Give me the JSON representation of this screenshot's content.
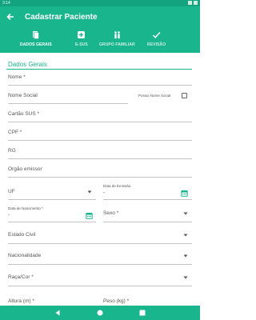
{
  "status_bar": {
    "time": "3:14"
  },
  "app_bar": {
    "title": "Cadastrar Paciente",
    "tabs": [
      {
        "label": "DADOS GERAIS",
        "icon": "document-icon",
        "active": true
      },
      {
        "label": "E-SUS",
        "icon": "medical-plus-icon",
        "active": false
      },
      {
        "label": "GRUPO FAMILIAR",
        "icon": "family-icon",
        "active": false
      },
      {
        "label": "REVISÃO",
        "icon": "check-icon",
        "active": false
      }
    ]
  },
  "form": {
    "section_title": "Dados Gerais",
    "nome": "Nome *",
    "nome_social": "Nome Social",
    "possui_nome_social": "Possui Nome Social",
    "cartao_sus": "Cartão SUS *",
    "cpf": "CPF *",
    "rg": "RG",
    "orgao_emissor": "Orgão emissor",
    "uf": "UF",
    "data_emissao_label": "Data de Emissão",
    "data_emissao_value": "-",
    "data_nascimento_label": "Data de Nascimento *",
    "data_nascimento_value": "-",
    "sexo": "Sexo *",
    "estado_civil": "Estado Civil",
    "nacionalidade": "Nacionalidade",
    "raca_cor": "Raça/Cor *",
    "altura": "Altura (m) *",
    "peso": "Peso (kg) *"
  },
  "colors": {
    "primary": "#19b58d",
    "status": "#13a37f",
    "divider": "#c4c4c4"
  }
}
